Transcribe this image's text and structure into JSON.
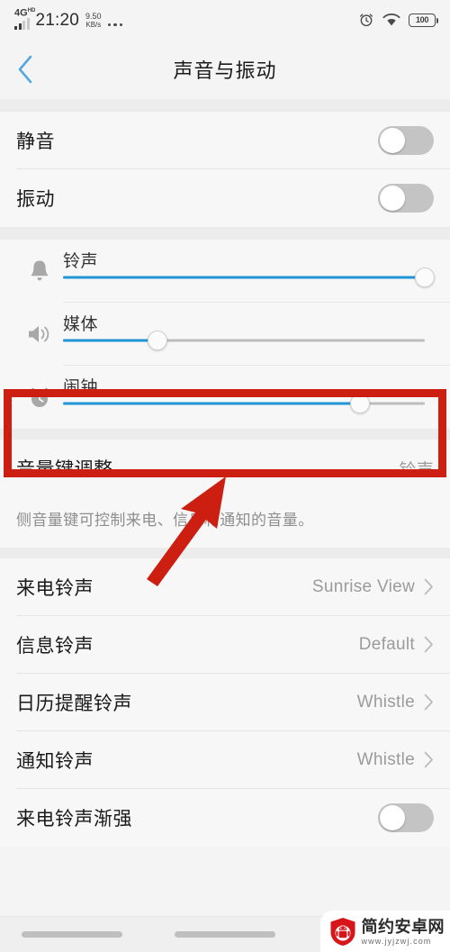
{
  "statusbar": {
    "network_type": "4G",
    "network_sup": "HD",
    "time": "21:20",
    "speed_value": "9.50",
    "speed_unit": "KB/s",
    "overflow_icon": "more-dots-icon",
    "alarm_icon": "alarm-clock-icon",
    "wifi_icon": "wifi-icon",
    "battery_level": "100"
  },
  "header": {
    "back_icon": "chevron-left-icon",
    "title": "声音与振动"
  },
  "toggles": [
    {
      "label": "静音",
      "state": "off"
    },
    {
      "label": "振动",
      "state": "off"
    }
  ],
  "sliders": [
    {
      "icon": "bell-icon",
      "label": "铃声",
      "value": 100
    },
    {
      "icon": "speaker-icon",
      "label": "媒体",
      "value": 26
    },
    {
      "icon": "alarm-clock-icon",
      "label": "闹钟",
      "value": 82
    }
  ],
  "volume_key": {
    "label": "音量键调整",
    "value": "铃声",
    "description": "侧音量键可控制来电、信息和通知的音量。"
  },
  "ringtones": [
    {
      "label": "来电铃声",
      "value": "Sunrise View"
    },
    {
      "label": "信息铃声",
      "value": "Default"
    },
    {
      "label": "日历提醒铃声",
      "value": "Whistle"
    },
    {
      "label": "通知铃声",
      "value": "Whistle"
    }
  ],
  "fade_in": {
    "label": "来电铃声渐强",
    "state": "off"
  },
  "annotation": {
    "highlight_color": "#cc1f12",
    "arrow_color": "#cc1f12",
    "target": "闹钟"
  },
  "watermark": {
    "site_name": "简约安卓网",
    "url": "www.jyjzwj.com",
    "logo_icon": "android-shield-icon"
  },
  "colors": {
    "accent": "#2196d6",
    "background": "#f4f4f4",
    "card": "#f7f7f7"
  }
}
